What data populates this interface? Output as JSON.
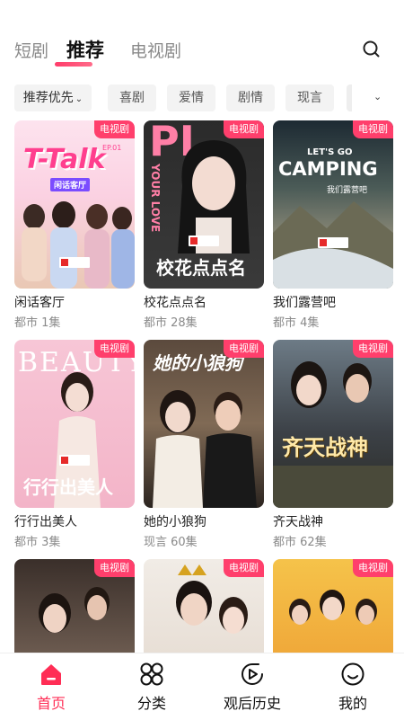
{
  "tabs": [
    {
      "label": "短剧",
      "active": false
    },
    {
      "label": "推荐",
      "active": true
    },
    {
      "label": "电视剧",
      "active": false
    }
  ],
  "search": {
    "icon": "search-icon"
  },
  "filters": {
    "first": "推荐优先",
    "chips": [
      "喜剧",
      "爱情",
      "剧情",
      "现言"
    ],
    "more_icon": "chevron-down-icon"
  },
  "badge_label": "电视剧",
  "cards": [
    {
      "title": "闲话客厅",
      "meta": "都市 1集",
      "poster_text": "T-Talk",
      "poster_sub": "闲话客厅",
      "ep": "EP.01"
    },
    {
      "title": "校花点点名",
      "meta": "都市 28集",
      "poster_text": "校花点点名",
      "poster_sub": "YOUR LOVE",
      "poster_big": "PL"
    },
    {
      "title": "我们露营吧",
      "meta": "都市 4集",
      "poster_text": "CAMPING",
      "poster_sub": "LET'S GO",
      "poster_small": "我们露营吧"
    },
    {
      "title": "行行出美人",
      "meta": "都市 3集",
      "poster_text": "行行出美人",
      "poster_sub": "BEAUTY"
    },
    {
      "title": "她的小狼狗",
      "meta": "现言 60集",
      "poster_text": "她的小狼狗"
    },
    {
      "title": "齐天战神",
      "meta": "都市 62集",
      "poster_text": "齐天战神"
    },
    {
      "title": "",
      "meta": "",
      "poster_text": ""
    },
    {
      "title": "",
      "meta": "",
      "poster_text": ""
    },
    {
      "title": "",
      "meta": "",
      "poster_text": ""
    }
  ],
  "bottom_nav": [
    {
      "label": "首页",
      "icon": "home-icon",
      "active": true
    },
    {
      "label": "分类",
      "icon": "category-icon",
      "active": false
    },
    {
      "label": "观后历史",
      "icon": "history-play-icon",
      "active": false
    },
    {
      "label": "我的",
      "icon": "profile-icon",
      "active": false
    }
  ],
  "colors": {
    "accent": "#ff3f6c",
    "active_nav": "#ff2d55"
  }
}
